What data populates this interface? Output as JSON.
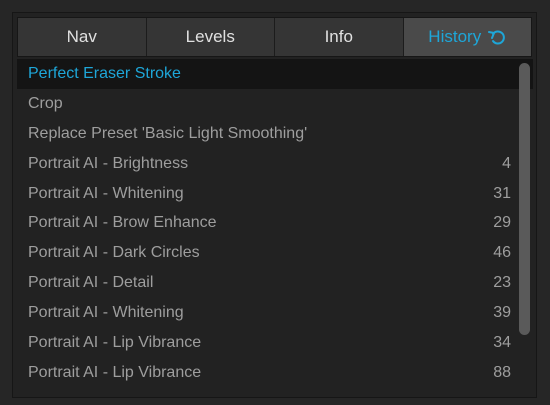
{
  "tabs": [
    {
      "label": "Nav"
    },
    {
      "label": "Levels"
    },
    {
      "label": "Info"
    },
    {
      "label": "History",
      "icon": "undo-arrow-icon",
      "active": true
    }
  ],
  "history": [
    {
      "label": "Perfect Eraser Stroke",
      "value": "",
      "selected": true
    },
    {
      "label": "Crop",
      "value": ""
    },
    {
      "label": "Replace Preset 'Basic Light Smoothing'",
      "value": ""
    },
    {
      "label": "Portrait AI - Brightness",
      "value": "4"
    },
    {
      "label": "Portrait AI - Whitening",
      "value": "31"
    },
    {
      "label": "Portrait AI - Brow Enhance",
      "value": "29"
    },
    {
      "label": "Portrait AI - Dark Circles",
      "value": "46"
    },
    {
      "label": "Portrait AI - Detail",
      "value": "23"
    },
    {
      "label": "Portrait AI - Whitening",
      "value": "39"
    },
    {
      "label": "Portrait AI - Lip Vibrance",
      "value": "34"
    },
    {
      "label": "Portrait AI - Lip Vibrance",
      "value": "88"
    }
  ],
  "colors": {
    "accent": "#1ea6d8",
    "text": "#9e9e9e",
    "selected_bg": "#141414"
  }
}
